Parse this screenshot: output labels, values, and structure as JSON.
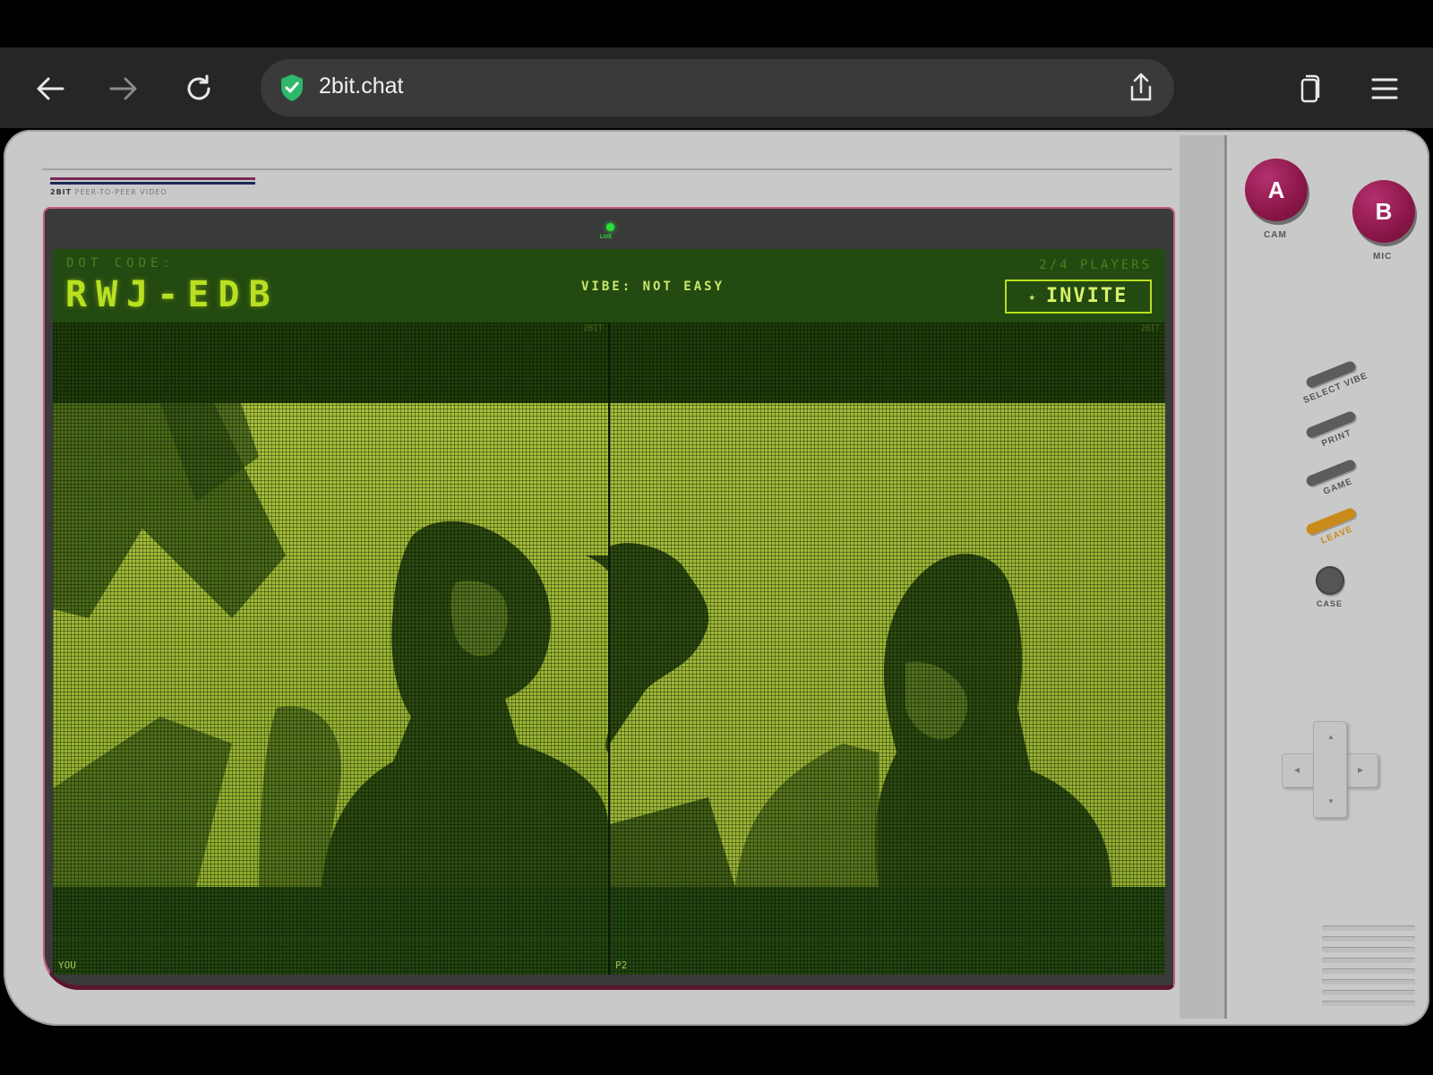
{
  "browser": {
    "url": "2bit.chat"
  },
  "brand": {
    "name": "2BIT",
    "tagline": "PEER-TO-PEER VIDEO"
  },
  "screen": {
    "live_label": "LIVE",
    "dot_code_label": "DOT CODE:",
    "dot_code": "RWJ-EDB",
    "vibe": "VIBE: NOT EASY",
    "players": "2/4 PLAYERS",
    "invite_star": "★",
    "invite_label": "INVITE",
    "feeds": [
      {
        "label": "YOU",
        "tag": "2BIT"
      },
      {
        "label": "P2",
        "tag": "2BIT"
      }
    ]
  },
  "controls": {
    "a_button": "A",
    "a_caption": "CAM",
    "b_button": "B",
    "b_caption": "MIC",
    "select_vibe": "SELECT VIBE",
    "print": "PRINT",
    "game": "GAME",
    "leave": "LEAVE",
    "case": "CASE"
  },
  "colors": {
    "accent": "#8a1648",
    "screen_green": "#b8e021",
    "leave_orange": "#c98a1a"
  }
}
